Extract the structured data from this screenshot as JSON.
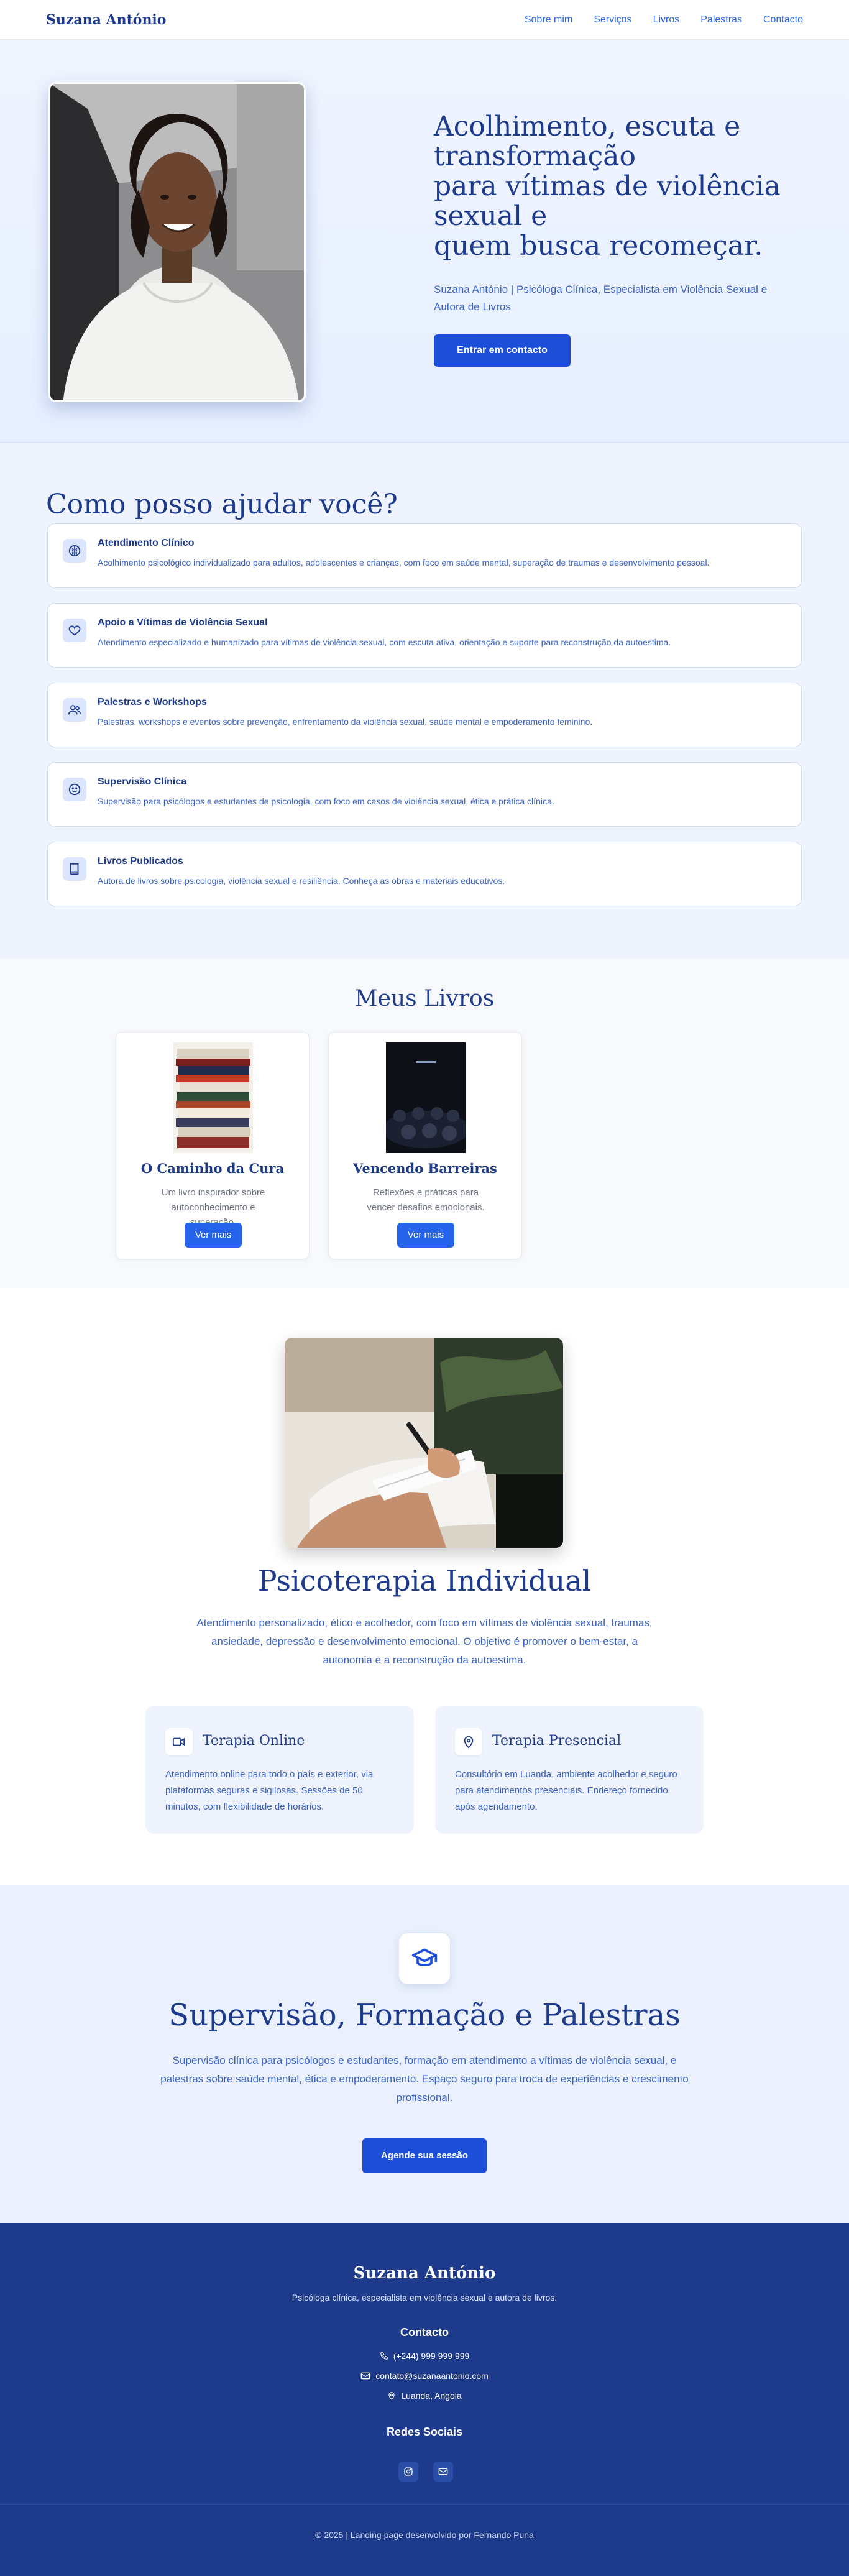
{
  "nav": {
    "brand": "Suzana António",
    "links": [
      "Sobre mim",
      "Serviços",
      "Livros",
      "Palestras",
      "Contacto"
    ]
  },
  "hero": {
    "title_lines": [
      "Acolhimento, escuta e transformação",
      "para vítimas de violência sexual e",
      "quem busca recomeçar."
    ],
    "subtitle": "Suzana António | Psicóloga Clínica, Especialista em Violência Sexual e Autora de Livros",
    "cta": "Entrar em contacto"
  },
  "services": {
    "heading": "Como posso ajudar você?",
    "items": [
      {
        "icon": "brain-icon",
        "title": "Atendimento Clínico",
        "desc": "Acolhimento psicológico individualizado para adultos, adolescentes e crianças, com foco em saúde mental, superação de traumas e desenvolvimento pessoal."
      },
      {
        "icon": "heart-icon",
        "title": "Apoio a Vítimas de Violência Sexual",
        "desc": "Atendimento especializado e humanizado para vítimas de violência sexual, com escuta ativa, orientação e suporte para reconstrução da autoestima."
      },
      {
        "icon": "users-icon",
        "title": "Palestras e Workshops",
        "desc": "Palestras, workshops e eventos sobre prevenção, enfrentamento da violência sexual, saúde mental e empoderamento feminino."
      },
      {
        "icon": "smile-icon",
        "title": "Supervisão Clínica",
        "desc": "Supervisão para psicólogos e estudantes de psicologia, com foco em casos de violência sexual, ética e prática clínica."
      },
      {
        "icon": "book-icon",
        "title": "Livros Publicados",
        "desc": "Autora de livros sobre psicologia, violência sexual e resiliência. Conheça as obras e materiais educativos."
      }
    ]
  },
  "books": {
    "heading": "Meus Livros",
    "items": [
      {
        "title": "O Caminho da Cura",
        "desc": "Um livro inspirador sobre autoconhecimento e superação.",
        "button": "Ver mais"
      },
      {
        "title": "Vencendo Barreiras",
        "desc": "Reflexões e práticas para vencer desafios emocionais.",
        "button": "Ver mais"
      }
    ]
  },
  "therapy": {
    "heading": "Psicoterapia Individual",
    "desc": "Atendimento personalizado, ético e acolhedor, com foco em vítimas de violência sexual, traumas, ansiedade, depressão e desenvolvimento emocional. O objetivo é promover o bem-estar, a autonomia e a reconstrução da autoestima.",
    "cards": [
      {
        "icon": "video-icon",
        "title": "Terapia Online",
        "desc": "Atendimento online para todo o país e exterior, via plataformas seguras e sigilosas. Sessões de 50 minutos, com flexibilidade de horários."
      },
      {
        "icon": "map-pin-icon",
        "title": "Terapia Presencial",
        "desc": "Consultório em Luanda, ambiente acolhedor e seguro para atendimentos presenciais. Endereço fornecido após agendamento."
      }
    ]
  },
  "supervision": {
    "heading": "Supervisão, Formação e Palestras",
    "desc": "Supervisão clínica para psicólogos e estudantes, formação em atendimento a vítimas de violência sexual, e palestras sobre saúde mental, ética e empoderamento. Espaço seguro para troca de experiências e crescimento profissional.",
    "cta": "Agende sua sessão"
  },
  "footer": {
    "brand": "Suzana António",
    "tagline": "Psicóloga clínica, especialista em violência sexual e autora de livros.",
    "contact_heading": "Contacto",
    "phone": "(+244) 999 999 999",
    "email": "contato@suzanaantonio.com",
    "location": "Luanda, Angola",
    "social_heading": "Redes Sociais",
    "copyright": "© 2025 | Landing page desenvolvido por Fernando Puna"
  },
  "colors": {
    "primary": "#1e3a8a",
    "accent": "#2563eb",
    "button": "#1d4ed8"
  }
}
